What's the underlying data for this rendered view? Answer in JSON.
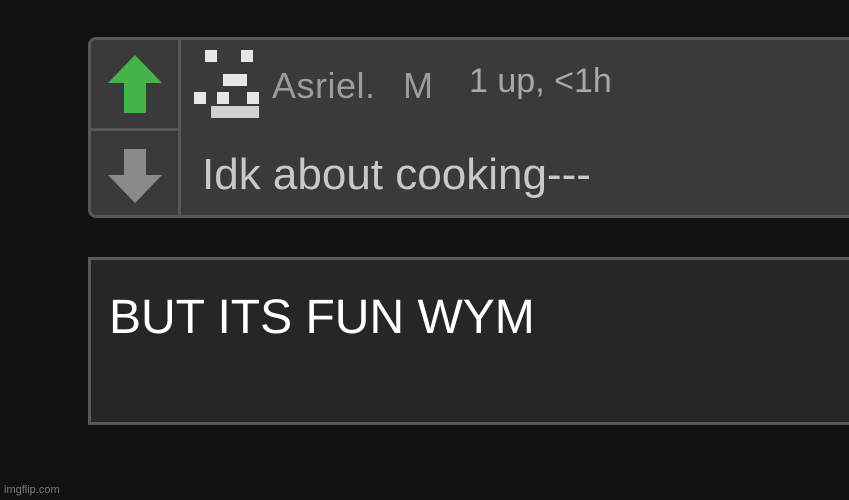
{
  "comment": {
    "username": "Asriel",
    "username_suffix": ".",
    "gender": "M",
    "meta": "1 up, <1h",
    "text": "Idk about cooking---",
    "upvote_icon": "arrow-up-icon",
    "downvote_icon": "arrow-down-icon",
    "upvote_color": "#45b448",
    "downvote_color": "#8a8a8a"
  },
  "reply": {
    "text": "BUT ITS FUN WYM"
  },
  "watermark": "imgflip.com",
  "colors": {
    "background": "#111111",
    "card": "#3a3a3a",
    "card_border": "#585858",
    "reply_box": "#262626"
  }
}
